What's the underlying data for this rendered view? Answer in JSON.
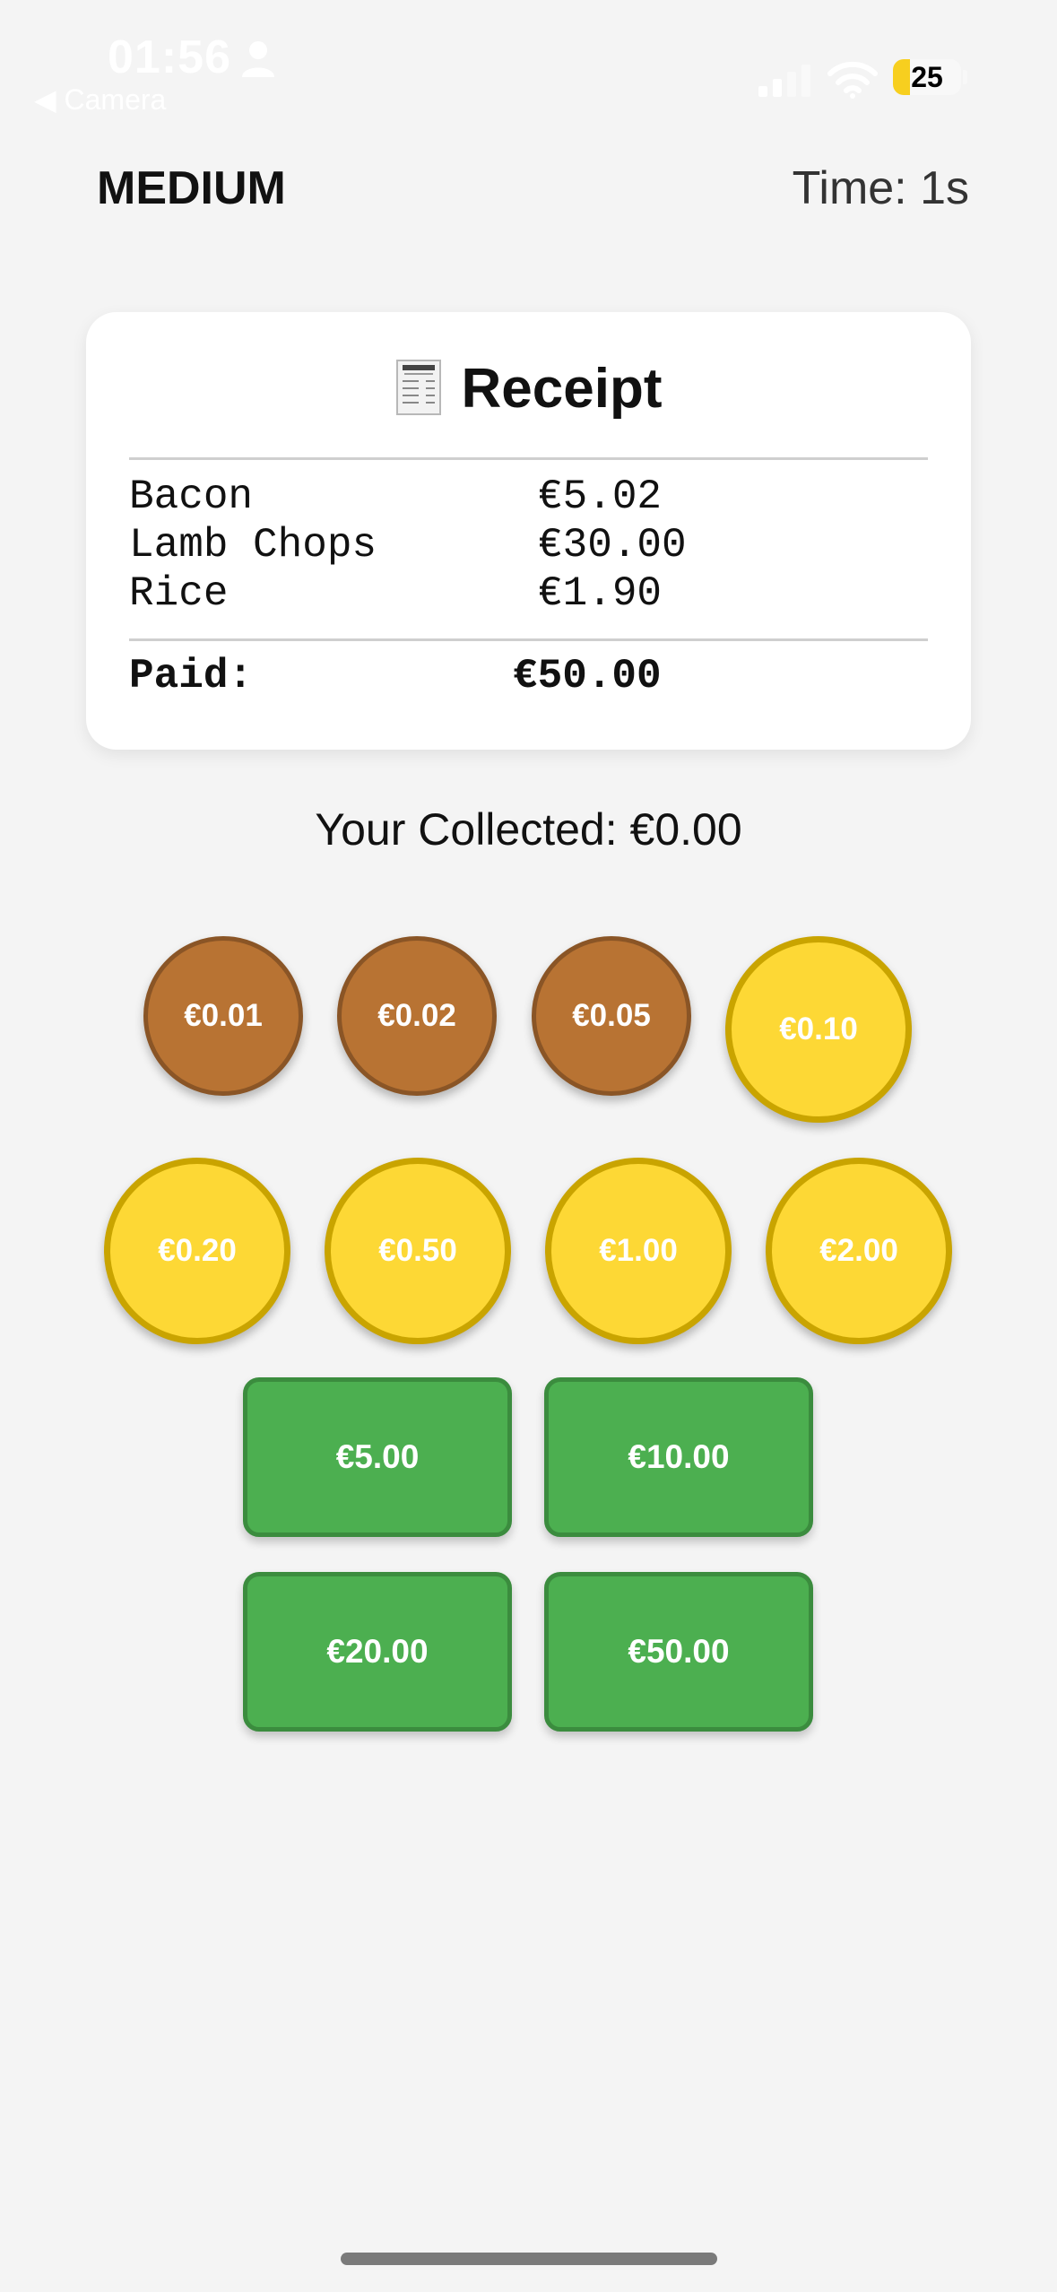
{
  "status_bar": {
    "time": "01:56",
    "back_label": "◀ Camera",
    "battery_level": "25",
    "battery_fraction": 0.25
  },
  "header": {
    "difficulty": "MEDIUM",
    "timer": "Time: 1s"
  },
  "receipt": {
    "title": "Receipt",
    "icon": "receipt-icon",
    "items": [
      {
        "name": "Bacon",
        "price": "€5.02"
      },
      {
        "name": "Lamb Chops",
        "price": "€30.00"
      },
      {
        "name": "Rice",
        "price": "€1.90"
      }
    ],
    "paid_label": "Paid:",
    "paid_value": "€50.00"
  },
  "collected_text": "Your Collected: €0.00",
  "coins": [
    {
      "label": "€0.01",
      "kind": "copper"
    },
    {
      "label": "€0.02",
      "kind": "copper"
    },
    {
      "label": "€0.05",
      "kind": "copper"
    },
    {
      "label": "€0.10",
      "kind": "gold"
    },
    {
      "label": "€0.20",
      "kind": "gold"
    },
    {
      "label": "€0.50",
      "kind": "gold"
    },
    {
      "label": "€1.00",
      "kind": "gold"
    },
    {
      "label": "€2.00",
      "kind": "gold"
    }
  ],
  "notes": [
    {
      "label": "€5.00"
    },
    {
      "label": "€10.00"
    },
    {
      "label": "€20.00"
    },
    {
      "label": "€50.00"
    }
  ],
  "colors": {
    "copper": "#b87333",
    "gold": "#fdd835",
    "note": "#4caf50",
    "background": "#f4f4f4"
  }
}
